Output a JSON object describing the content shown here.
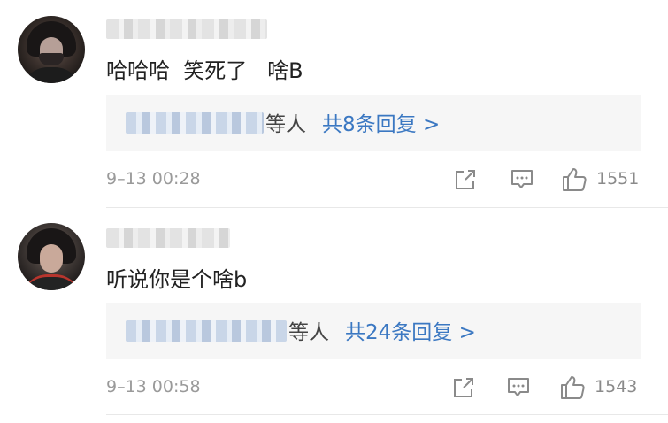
{
  "comments": [
    {
      "username": "",
      "text": "哈哈哈  笑死了   啥B",
      "replies": {
        "names_suffix": "等人",
        "link": "共8条回复 >"
      },
      "time": "9–13 00:28",
      "likes": "1551",
      "avatar_icon": "user-avatar-icon"
    },
    {
      "username": "",
      "text": "听说你是个啥b",
      "replies": {
        "names_suffix": "等人",
        "link": "共24条回复 >"
      },
      "time": "9–13 00:58",
      "likes": "1543",
      "avatar_icon": "user-avatar-icon"
    }
  ],
  "icons": {
    "share": "share-icon",
    "comment": "comment-icon",
    "like": "thumbs-up-icon"
  },
  "colors": {
    "link": "#3b78c2",
    "text": "#222222",
    "meta": "#9a9a9a",
    "reply_bg": "#f6f6f6"
  }
}
